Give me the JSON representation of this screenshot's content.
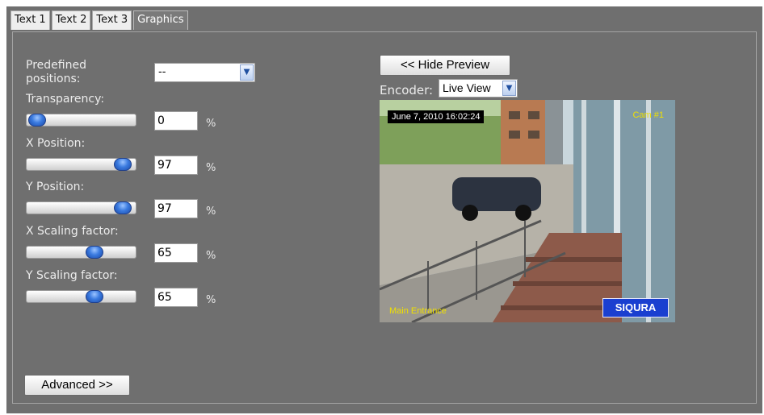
{
  "tabs": [
    {
      "label": "Text 1"
    },
    {
      "label": "Text 2"
    },
    {
      "label": "Text 3"
    },
    {
      "label": "Graphics"
    }
  ],
  "settings": {
    "predefined_positions": {
      "label": "Predefined\npositions:",
      "value": "--"
    },
    "transparency": {
      "label": "Transparency:",
      "value": "0",
      "unit": "%",
      "level": 0.0
    },
    "x_position": {
      "label": "X Position:",
      "value": "97",
      "unit": "%",
      "level": 0.97
    },
    "y_position": {
      "label": "Y Position:",
      "value": "97",
      "unit": "%",
      "level": 0.97
    },
    "x_scaling": {
      "label": "X Scaling factor:",
      "value": "65",
      "unit": "%",
      "level": 0.65
    },
    "y_scaling": {
      "label": "Y Scaling factor:",
      "value": "65",
      "unit": "%",
      "level": 0.65
    }
  },
  "advanced_button": "Advanced >>",
  "preview": {
    "hide_button": "<< Hide Preview",
    "encoder_label": "Encoder:",
    "encoder_value": "Live View",
    "timestamp": "June 7, 2010 16:02:24",
    "camera_name": "Cam #1",
    "location": "Main Entrance",
    "logo": "SIQURA"
  },
  "colors": {
    "panel_bg": "#6f6f6f",
    "slider_thumb": "#3b7be0",
    "overlay_text": "#f0e000",
    "logo_bg": "#1a3fd0"
  }
}
